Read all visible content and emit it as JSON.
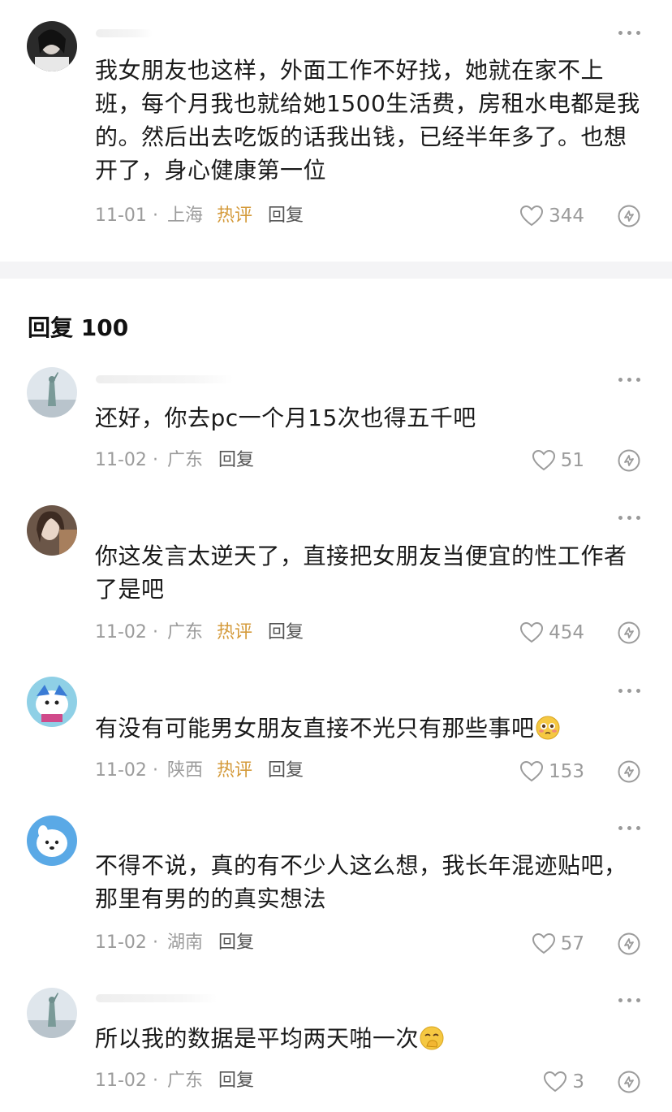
{
  "top_comment": {
    "text": "我女朋友也这样，外面工作不好找，她就在家不上班，每个月我也就给她1500生活费，房租水电都是我的。然后出去吃饭的话我出钱，已经半年多了。也想开了，身心健康第一位",
    "date": "11-01",
    "location": "上海",
    "hot": "热评",
    "reply": "回复",
    "likes": "344"
  },
  "replies_header": "回复 100",
  "replies": [
    {
      "text": "还好，你去pc一个月15次也得五千吧",
      "date": "11-02",
      "location": "广东",
      "reply": "回复",
      "likes": "51"
    },
    {
      "text": "你这发言太逆天了，直接把女朋友当便宜的性工作者了是吧",
      "date": "11-02",
      "location": "广东",
      "hot": "热评",
      "reply": "回复",
      "likes": "454"
    },
    {
      "text": "有没有可能男女朋友直接不光只有那些事吧",
      "date": "11-02",
      "location": "陕西",
      "hot": "热评",
      "reply": "回复",
      "likes": "153"
    },
    {
      "text": "不得不说，真的有不少人这么想，我长年混迹贴吧，那里有男的的真实想法",
      "date": "11-02",
      "location": "湖南",
      "reply": "回复",
      "likes": "57"
    },
    {
      "text": "所以我的数据是平均两天啪一次",
      "date": "11-02",
      "location": "广东",
      "reply": "回复",
      "likes": "3"
    }
  ],
  "meta_separator": "·",
  "icons": [
    "more-icon",
    "heart-icon",
    "share-icon"
  ],
  "colors": {
    "hot_badge": "#d49a3a",
    "meta": "#9b9b9b",
    "divider": "#f4f4f6"
  }
}
